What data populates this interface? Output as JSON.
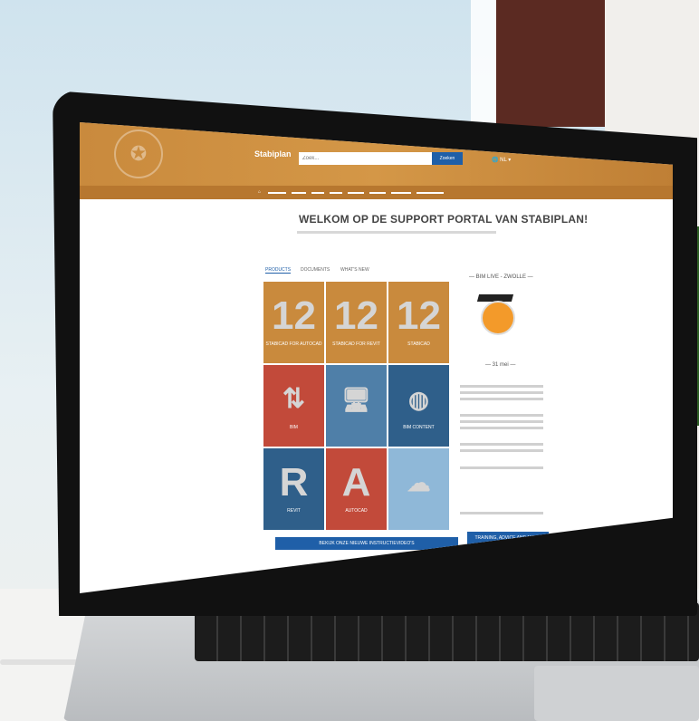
{
  "colors": {
    "header_brown": "#c98a3d",
    "accent_blue": "#1f5fa8",
    "tile_orange": "#c98a3d",
    "tile_red": "#c24a3a",
    "tile_blue": "#2f5f8a"
  },
  "header": {
    "brand": "Stabiplan",
    "search_placeholder": "Zoek...",
    "search_button": "Zoeken",
    "language": "NL"
  },
  "main": {
    "welcome": "WELKOM OP DE SUPPORT PORTAL VAN STABIPLAN!",
    "tabs": [
      "PRODUCTS",
      "DOCUMENTS",
      "WHAT'S NEW"
    ],
    "tiles": [
      {
        "big": "12",
        "label": "STABICAD FOR AUTOCAD"
      },
      {
        "big": "12",
        "label": "STABICAD FOR REVIT"
      },
      {
        "big": "12",
        "label": "STABICAD"
      },
      {
        "big": "",
        "label": "BIM"
      },
      {
        "big": "",
        "label": ""
      },
      {
        "big": "",
        "label": "BIM CONTENT"
      },
      {
        "big": "R",
        "label": "REVIT"
      },
      {
        "big": "A",
        "label": "AUTOCAD"
      },
      {
        "big": "",
        "label": ""
      }
    ],
    "cta_left": "BEKIJK ONZE NIEUWE INSTRUCTIEVIDEO'S",
    "cta_right": "TRAINING, ADVICE AND MORE"
  },
  "sidebar": {
    "title": "— BIM LIVE - ZWOLLE —",
    "date": "— 31 mei —"
  }
}
